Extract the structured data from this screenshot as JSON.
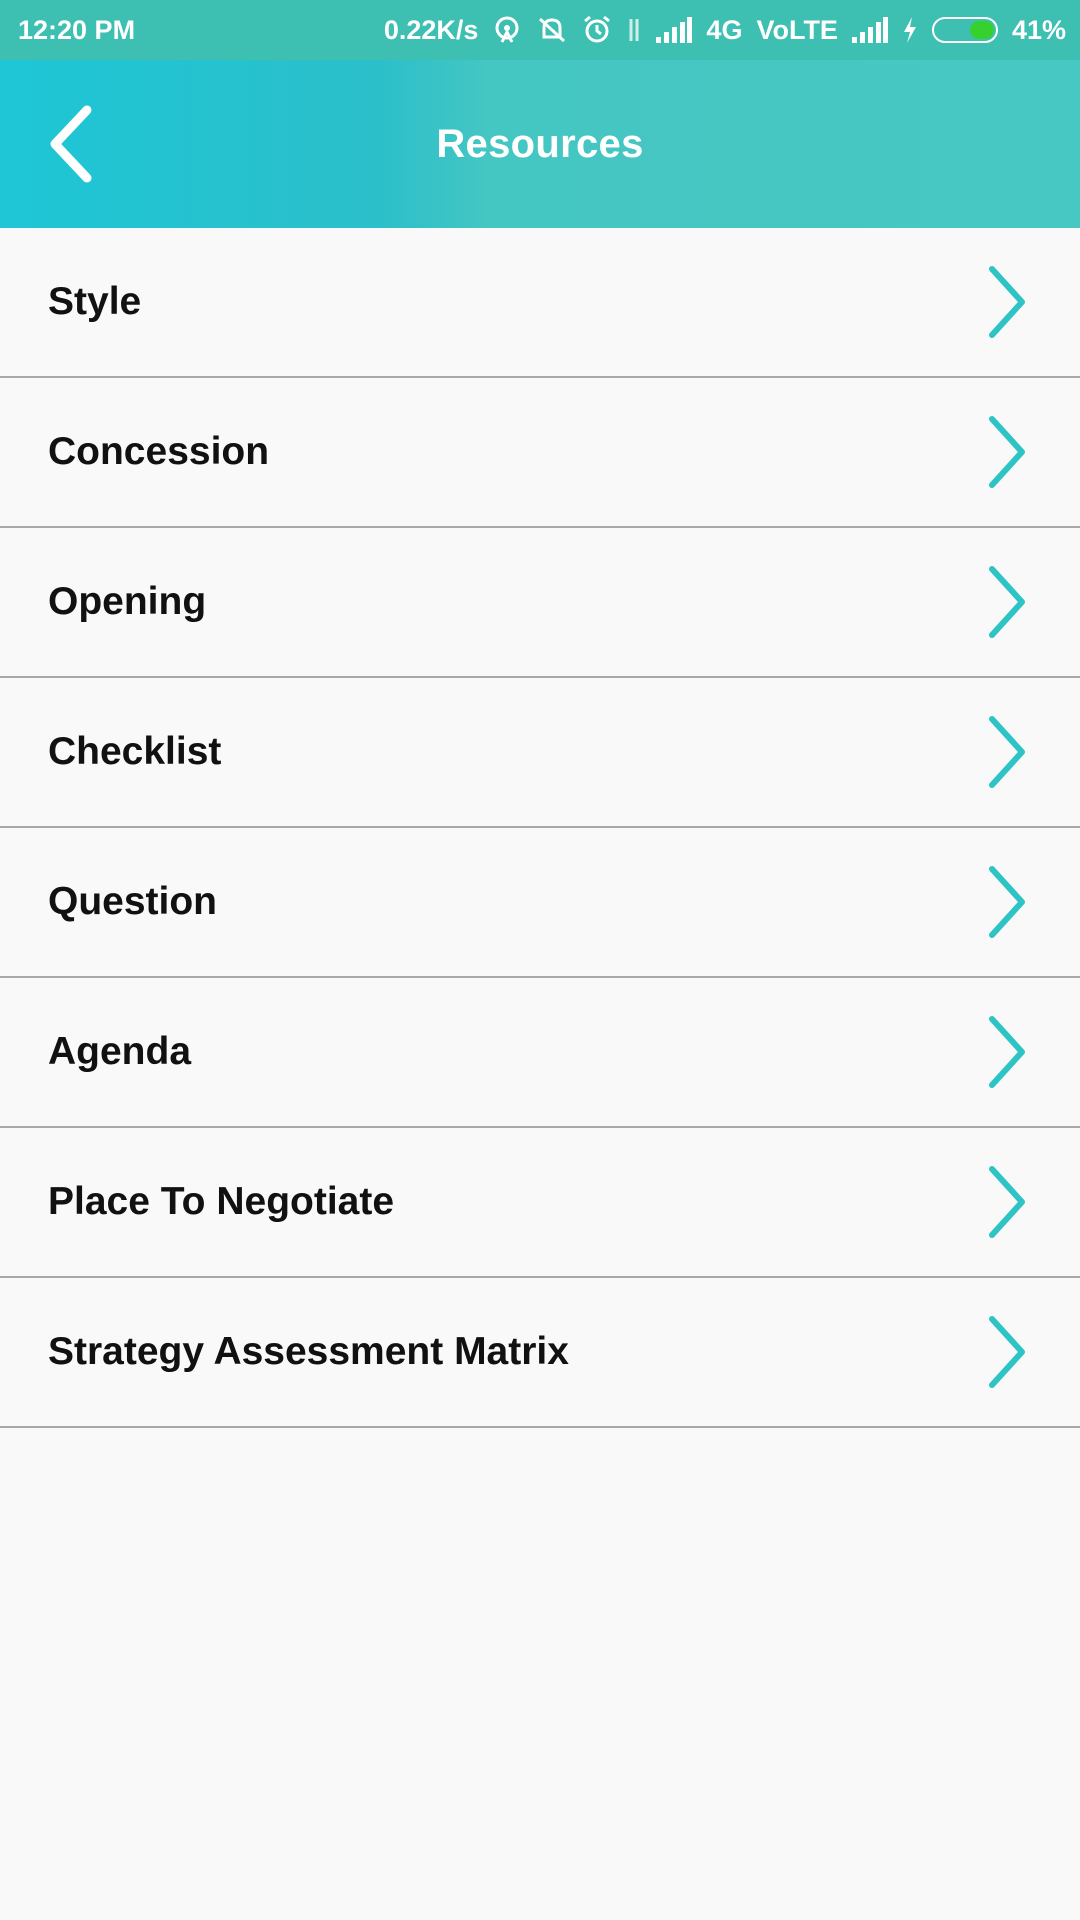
{
  "status_bar": {
    "time": "12:20 PM",
    "net_speed": "0.22K/s",
    "network": "4G",
    "volte": "VoLTE",
    "battery": "41%",
    "icons": [
      "hotspot-icon",
      "muted-alarm-icon",
      "alarm-icon",
      "data-arrows-icon",
      "signal-icon",
      "signal-icon",
      "charging-icon",
      "battery-icon"
    ],
    "battery_level": 0.41
  },
  "app_bar": {
    "title": "Resources",
    "back_icon": "back-arrow-icon"
  },
  "list": {
    "items": [
      {
        "label": "Style"
      },
      {
        "label": "Concession"
      },
      {
        "label": "Opening"
      },
      {
        "label": "Checklist"
      },
      {
        "label": "Question"
      },
      {
        "label": "Agenda"
      },
      {
        "label": "Place To Negotiate"
      },
      {
        "label": "Strategy Assessment Matrix"
      }
    ],
    "chevron_icon": "chevron-right-icon"
  },
  "colors": {
    "accent": "#2ec3c4",
    "status_bar": "#3dbfb1",
    "battery_fill": "#36d12e"
  }
}
